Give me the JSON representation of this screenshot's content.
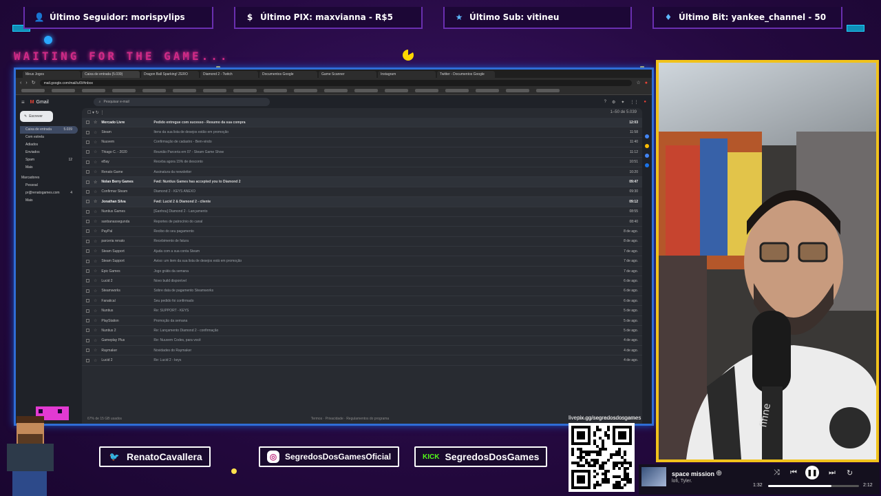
{
  "alerts": {
    "follower": "Último Seguidor: morispylips",
    "pix": "Último PIX: maxvianna - R$5",
    "sub": "Último Sub: vitineu",
    "bit": "Último Bit: yankee_channel - 50"
  },
  "waiting_text": "WAITING FOR THE GAME...",
  "browser": {
    "tabs": [
      "Meus Jogos",
      "Caixa de entrada (5.039)",
      "Dragon Ball Sparking! ZERO",
      "Diamond 2 - Twitch",
      "Documentos Google",
      "Game Scanner",
      "Instagram",
      "Twitter - Documentos Google"
    ],
    "url": "mail.google.com/mail/u/0/#inbox"
  },
  "gmail": {
    "logo": "Gmail",
    "search_placeholder": "Pesquisar e-mail",
    "compose": "Escrever",
    "sidebar": [
      {
        "label": "Caixa de entrada",
        "count": "5.039"
      },
      {
        "label": "Com estrela",
        "count": ""
      },
      {
        "label": "Adiados",
        "count": ""
      },
      {
        "label": "Enviados",
        "count": ""
      },
      {
        "label": "Spam",
        "count": "12"
      },
      {
        "label": "Mais",
        "count": ""
      }
    ],
    "labels_header": "Marcadores",
    "labels": [
      {
        "label": "Pessoal",
        "count": ""
      },
      {
        "label": "pr@renatogames.com",
        "count": "4"
      },
      {
        "label": "Mais",
        "count": ""
      }
    ],
    "pagination": "1–50 de 5.039",
    "rows": [
      {
        "sender": "Mercado Livre",
        "subject": "Pedido entregue com sucesso - Resumo da sua compra",
        "date": "12:03",
        "unread": true
      },
      {
        "sender": "Steam",
        "subject": "Itens da sua lista de desejos estão em promoção",
        "date": "11:58",
        "unread": false
      },
      {
        "sender": "Nuuvem",
        "subject": "Confirmação de cadastro - Bem-vindo",
        "date": "11:40",
        "unread": false
      },
      {
        "sender": "Thiago C. - 2020",
        "subject": "Reunião Parceria em 07 - Steam Game Show",
        "date": "11:12",
        "unread": false
      },
      {
        "sender": "eBay",
        "subject": "Receba agora 15% de desconto",
        "date": "10:51",
        "unread": false
      },
      {
        "sender": "Renato Game",
        "subject": "Assinatura da newsletter",
        "date": "10:20",
        "unread": false
      },
      {
        "sender": "Nolan Berry Games",
        "subject": "Fwd: Nuntius Games has accepted you to Diamond 2",
        "date": "09:47",
        "unread": true
      },
      {
        "sender": "Confirmar Steam",
        "subject": "Diamond 2 - KEYS ANEXO",
        "date": "09:30",
        "unread": false
      },
      {
        "sender": "Jonathan Silva",
        "subject": "Fwd: Lucid 2 & Diamond 2 - cliente",
        "date": "09:12",
        "unread": true
      },
      {
        "sender": "Nuntius Games",
        "subject": "[Ganhou] Diamond 2 - Lançamento",
        "date": "08:55",
        "unread": false
      },
      {
        "sender": "sanbanassegunda",
        "subject": "Reportes de patrocínio do canal",
        "date": "08:40",
        "unread": false
      },
      {
        "sender": "PayPal",
        "subject": "Recibo do seu pagamento",
        "date": "8 de ago.",
        "unread": false
      },
      {
        "sender": "parceria renato",
        "subject": "Recebimento de fatura",
        "date": "8 de ago.",
        "unread": false
      },
      {
        "sender": "Steam Support",
        "subject": "Ajuda com a sua conta Steam",
        "date": "7 de ago.",
        "unread": false
      },
      {
        "sender": "Steam Support",
        "subject": "Aviso: um item da sua lista de desejos está em promoção",
        "date": "7 de ago.",
        "unread": false
      },
      {
        "sender": "Epic Games",
        "subject": "Jogo grátis da semana",
        "date": "7 de ago.",
        "unread": false
      },
      {
        "sender": "Lucid 2",
        "subject": "Novo build disponível",
        "date": "6 de ago.",
        "unread": false
      },
      {
        "sender": "Steamworks",
        "subject": "Sobre data de pagamento Steamworks",
        "date": "6 de ago.",
        "unread": false
      },
      {
        "sender": "Fanatical",
        "subject": "Seu pedido foi confirmado",
        "date": "6 de ago.",
        "unread": false
      },
      {
        "sender": "Nuntius",
        "subject": "Re: SUPPORT - KEYS",
        "date": "5 de ago.",
        "unread": false
      },
      {
        "sender": "PlayStation",
        "subject": "Promoção da semana",
        "date": "5 de ago.",
        "unread": false
      },
      {
        "sender": "Nuntius 2",
        "subject": "Re: Lançamento Diamond 2 - confirmação",
        "date": "5 de ago.",
        "unread": false
      },
      {
        "sender": "Gameplay Plus",
        "subject": "Re: Nuuvem Codes, para você",
        "date": "4 de ago.",
        "unread": false
      },
      {
        "sender": "Raymaker",
        "subject": "Novidades do Raymaker",
        "date": "4 de ago.",
        "unread": false
      },
      {
        "sender": "Lucid 2",
        "subject": "Re: Lucid 2 - keys",
        "date": "4 de ago.",
        "unread": false
      }
    ],
    "footer_left": "67% de 15 GB usados",
    "footer_center": "Termos · Privacidade · Regulamentos do programa",
    "footer_right": "Última atividade da conta: há 1 minuto"
  },
  "social": {
    "twitter": "RenatoCavallera",
    "instagram": "SegredosDosGamesOficial",
    "kick": "SegredosDosGames",
    "kick_badge": "KICK"
  },
  "qr_label": "livepix.gg/segredosdosgames",
  "player": {
    "song": "space mission",
    "artist": "lofi, Tyler.",
    "elapsed": "1:32",
    "duration": "2:12",
    "progress": 0.7
  },
  "colors": {
    "accent_blue": "#2f6dd6",
    "cam_border": "#f1c21b",
    "waiting_pink": "#d02a86"
  }
}
